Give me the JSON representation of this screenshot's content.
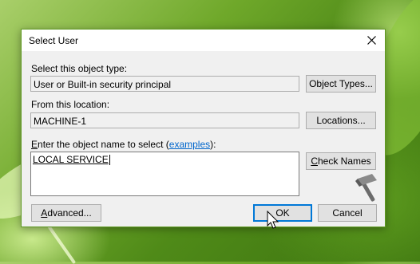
{
  "dialog": {
    "title": "Select User",
    "object_type": {
      "label": "Select this object type:",
      "value": "User or Built-in security principal",
      "button": "Object Types..."
    },
    "location": {
      "label": "From this location:",
      "value": "MACHINE-1",
      "button": "Locations..."
    },
    "object_name": {
      "label_prefix_ul": "E",
      "label_prefix": "nter the object name to select (",
      "link": "examples",
      "label_suffix": "):",
      "value": "LOCAL SERVICE",
      "button_ul": "C",
      "button_rest": "heck Names"
    },
    "advanced_ul": "A",
    "advanced_rest": "dvanced...",
    "ok": "OK",
    "cancel": "Cancel"
  },
  "icons": {
    "close": "close-icon",
    "cursor": "mouse-pointer-icon",
    "watermark": "hammer-logo-icon"
  },
  "colors": {
    "accent": "#0078d7",
    "link": "#0066cc",
    "dialog_border": "#5f9a22"
  }
}
